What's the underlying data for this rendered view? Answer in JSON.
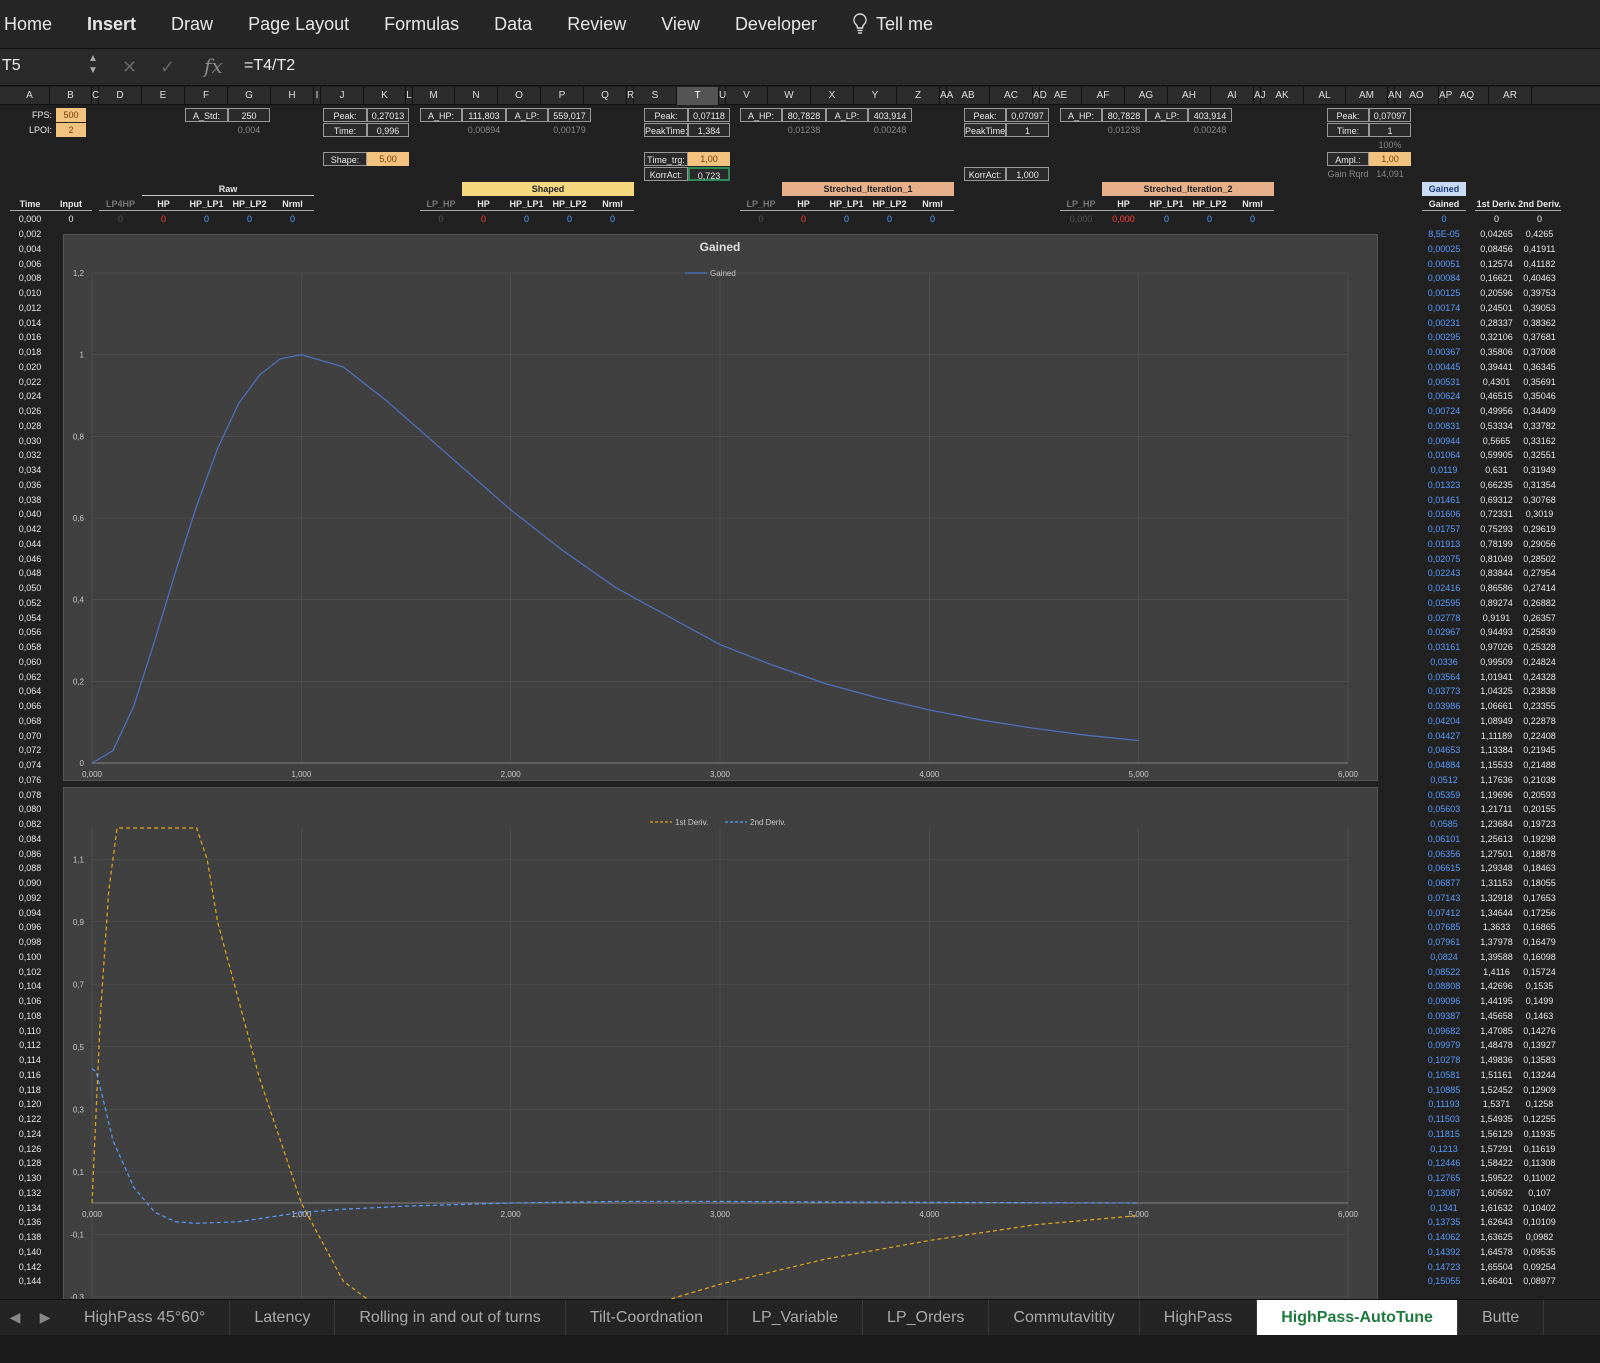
{
  "ribbon": {
    "tabs": [
      "Home",
      "Insert",
      "Draw",
      "Page Layout",
      "Formulas",
      "Data",
      "Review",
      "View",
      "Developer"
    ],
    "tell_me": "Tell me"
  },
  "formula_bar": {
    "name_box": "T5",
    "formula": "=T4/T2",
    "fx": "fx"
  },
  "columns": [
    "A",
    "B",
    "C",
    "D",
    "E",
    "F",
    "G",
    "H",
    "I",
    "J",
    "K",
    "L",
    "M",
    "N",
    "O",
    "P",
    "Q",
    "R",
    "S",
    "T",
    "U",
    "V",
    "W",
    "X",
    "Y",
    "Z",
    "AA",
    "AB",
    "AC",
    "AD",
    "AE",
    "AF",
    "AG",
    "AH",
    "AI",
    "AJ",
    "AK",
    "AL",
    "AM",
    "AN",
    "AO",
    "AP",
    "AQ",
    "AR"
  ],
  "selected_column": "T",
  "params": {
    "fps_label": "FPS:",
    "fps": "500",
    "lpoi_label": "LPOI:",
    "lpoi": "2",
    "astd_label": "A_Std:",
    "astd": "250",
    "astd2": "0,004",
    "peak_label": "Peak:",
    "peak_k": "0,27013",
    "time_label": "Time:",
    "time_k": "0,996",
    "shape_label": "Shape:",
    "shape": "5,00",
    "ahp_label": "A_HP:",
    "ahp_n": "111,803",
    "alp_label": "A_LP:",
    "alp_p": "559,017",
    "n2": "0,00894",
    "p2": "0,00179",
    "peak_t": "0,07118",
    "peaktime_label": "PeakTime:",
    "peaktime_t": "1,384",
    "timetrg_label": "Time_trg:",
    "timetrg": "1,00",
    "korract_label": "KorrAct:",
    "korract_t": "0,723",
    "ahp_w": "80,7828",
    "alp_y": "403,914",
    "w2": "0,01238",
    "y2": "0,00248",
    "peak_ac": "0,07097",
    "peaktime_ac": "1",
    "korract_ac": "1,000",
    "ahp_af": "80,7828",
    "alp_ah": "403,914",
    "af2": "0,01238",
    "ah2": "0,00248",
    "peak_am": "0,07097",
    "time_am": "1",
    "pct": "100%",
    "ampl_label": "Ampl.:",
    "ampl": "1,00",
    "gainrqrd_label": "Gain Rqrd",
    "gainrqrd": "14,091"
  },
  "bands": {
    "raw": "Raw",
    "shaped": "Shaped",
    "str1": "Streched_Iteration_1",
    "str2": "Streched_Iteration_2",
    "gained": "Gained"
  },
  "headers": {
    "time": "Time",
    "input": "Input",
    "lp4hp": "LP4HP",
    "hp": "HP",
    "hp_lp1": "HP_LP1",
    "hp_lp2": "HP_LP2",
    "nrml": "Nrml",
    "lp_hp": "LP_HP",
    "first_deriv": "1st Deriv.",
    "second_deriv": "2nd Deriv."
  },
  "row0": {
    "time": "0,000",
    "input": "0",
    "zero": "0",
    "af": "0,000"
  },
  "times": [
    "0,002",
    "0,004",
    "0,006",
    "0,008",
    "0,010",
    "0,012",
    "0,014",
    "0,016",
    "0,018",
    "0,020",
    "0,022",
    "0,024",
    "0,026",
    "0,028",
    "0,030",
    "0,032",
    "0,034",
    "0,036",
    "0,038",
    "0,040",
    "0,042",
    "0,044",
    "0,046",
    "0,048",
    "0,050",
    "0,052",
    "0,054",
    "0,056",
    "0,058",
    "0,060",
    "0,062",
    "0,064",
    "0,066",
    "0,068",
    "0,070",
    "0,072",
    "0,074",
    "0,076",
    "0,078",
    "0,080",
    "0,082",
    "0,084",
    "0,086",
    "0,088",
    "0,090",
    "0,092",
    "0,094",
    "0,096",
    "0,098",
    "0,100",
    "0,102",
    "0,104",
    "0,106",
    "0,108",
    "0,110",
    "0,112",
    "0,114",
    "0,116",
    "0,118",
    "0,120",
    "0,122",
    "0,124",
    "0,126",
    "0,128",
    "0,130",
    "0,132",
    "0,134",
    "0,136",
    "0,138",
    "0,140",
    "0,142",
    "0,144"
  ],
  "gained": [
    "8,5E-05",
    "0,00025",
    "0,00051",
    "0,00084",
    "0,00125",
    "0,00174",
    "0,00231",
    "0,00295",
    "0,00367",
    "0,00445",
    "0,00531",
    "0,00624",
    "0,00724",
    "0,00831",
    "0,00944",
    "0,01064",
    "0,0119",
    "0,01323",
    "0,01461",
    "0,01606",
    "0,01757",
    "0,01913",
    "0,02075",
    "0,02243",
    "0,02416",
    "0,02595",
    "0,02778",
    "0,02967",
    "0,03161",
    "0,0336",
    "0,03564",
    "0,03773",
    "0,03986",
    "0,04204",
    "0,04427",
    "0,04653",
    "0,04884",
    "0,0512",
    "0,05359",
    "0,05603",
    "0,0585",
    "0,06101",
    "0,06356",
    "0,06615",
    "0,06877",
    "0,07143",
    "0,07412",
    "0,07685",
    "0,07961",
    "0,0824",
    "0,08522",
    "0,08808",
    "0,09096",
    "0,09387",
    "0,09682",
    "0,09979",
    "0,10278",
    "0,10581",
    "0,10885",
    "0,11193",
    "0,11503",
    "0,11815",
    "0,1213",
    "0,12446",
    "0,12765",
    "0,13087",
    "0,1341",
    "0,13735",
    "0,14062",
    "0,14392",
    "0,14723",
    "0,15055"
  ],
  "d1": [
    "0,04265",
    "0,08456",
    "0,12574",
    "0,16621",
    "0,20596",
    "0,24501",
    "0,28337",
    "0,32106",
    "0,35806",
    "0,39441",
    "0,4301",
    "0,46515",
    "0,49956",
    "0,53334",
    "0,5665",
    "0,59905",
    "0,631",
    "0,66235",
    "0,69312",
    "0,72331",
    "0,75293",
    "0,78199",
    "0,81049",
    "0,83844",
    "0,86586",
    "0,89274",
    "0,9191",
    "0,94493",
    "0,97026",
    "0,99509",
    "1,01941",
    "1,04325",
    "1,06661",
    "1,08949",
    "1,11189",
    "1,13384",
    "1,15533",
    "1,17636",
    "1,19696",
    "1,21711",
    "1,23684",
    "1,25613",
    "1,27501",
    "1,29348",
    "1,31153",
    "1,32918",
    "1,34644",
    "1,3633",
    "1,37978",
    "1,39588",
    "1,4116",
    "1,42696",
    "1,44195",
    "1,45658",
    "1,47085",
    "1,48478",
    "1,49836",
    "1,51161",
    "1,52452",
    "1,5371",
    "1,54935",
    "1,56129",
    "1,57291",
    "1,58422",
    "1,59522",
    "1,60592",
    "1,61632",
    "1,62643",
    "1,63625",
    "1,64578",
    "1,65504",
    "1,66401"
  ],
  "d2": [
    "0,4265",
    "0,41911",
    "0,41182",
    "0,40463",
    "0,39753",
    "0,39053",
    "0,38362",
    "0,37681",
    "0,37008",
    "0,36345",
    "0,35691",
    "0,35046",
    "0,34409",
    "0,33782",
    "0,33162",
    "0,32551",
    "0,31949",
    "0,31354",
    "0,30768",
    "0,3019",
    "0,29619",
    "0,29056",
    "0,28502",
    "0,27954",
    "0,27414",
    "0,26882",
    "0,26357",
    "0,25839",
    "0,25328",
    "0,24824",
    "0,24328",
    "0,23838",
    "0,23355",
    "0,22878",
    "0,22408",
    "0,21945",
    "0,21488",
    "0,21038",
    "0,20593",
    "0,20155",
    "0,19723",
    "0,19298",
    "0,18878",
    "0,18463",
    "0,18055",
    "0,17653",
    "0,17256",
    "0,16865",
    "0,16479",
    "0,16098",
    "0,15724",
    "0,1535",
    "0,1499",
    "0,1463",
    "0,14276",
    "0,13927",
    "0,13583",
    "0,13244",
    "0,12909",
    "0,1258",
    "0,12255",
    "0,11935",
    "0,11619",
    "0,11308",
    "0,11002",
    "0,107",
    "0,10402",
    "0,10109",
    "0,0982",
    "0,09535",
    "0,09254",
    "0,08977"
  ],
  "chart_data": [
    {
      "type": "line",
      "title": "Gained",
      "series": [
        {
          "name": "Gained",
          "color": "#4f72c4",
          "x": [
            0,
            0.1,
            0.2,
            0.3,
            0.4,
            0.5,
            0.6,
            0.7,
            0.8,
            0.9,
            1.0,
            1.2,
            1.4,
            1.6,
            1.8,
            2.0,
            2.25,
            2.5,
            2.75,
            3.0,
            3.25,
            3.5,
            3.75,
            4.0,
            4.25,
            4.5,
            4.75,
            5.0
          ],
          "y": [
            0,
            0.03,
            0.14,
            0.3,
            0.47,
            0.63,
            0.77,
            0.88,
            0.95,
            0.99,
            1.0,
            0.97,
            0.89,
            0.8,
            0.71,
            0.62,
            0.52,
            0.43,
            0.36,
            0.29,
            0.24,
            0.195,
            0.16,
            0.13,
            0.105,
            0.085,
            0.068,
            0.055
          ]
        }
      ],
      "xlim": [
        0,
        6
      ],
      "ylim": [
        0,
        1.2
      ],
      "xticks": [
        "0,000",
        "1,000",
        "2,000",
        "3,000",
        "4,000",
        "5,000",
        "6,000"
      ],
      "yticks": [
        "0",
        "0,2",
        "0,4",
        "0,6",
        "0,8",
        "1",
        "1,2"
      ],
      "legend": "top"
    },
    {
      "type": "line",
      "series": [
        {
          "name": "1st Deriv.",
          "color": "#e6a81c",
          "dash": true,
          "x": [
            0,
            0.04,
            0.08,
            0.12,
            0.5,
            0.55,
            0.6,
            0.8,
            1.0,
            1.2,
            1.5,
            2.0,
            2.5,
            3.0,
            3.5,
            4.0,
            4.5,
            5.0
          ],
          "y": [
            0,
            0.6,
            1.0,
            1.3,
            1.3,
            1.1,
            0.9,
            0.4,
            0.0,
            -0.25,
            -0.4,
            -0.48,
            -0.36,
            -0.26,
            -0.18,
            -0.12,
            -0.07,
            -0.04
          ]
        },
        {
          "name": "2nd Deriv.",
          "color": "#5a9bff",
          "dash": true,
          "x": [
            0,
            0.02,
            0.05,
            0.1,
            0.2,
            0.3,
            0.4,
            0.5,
            0.7,
            0.9,
            1.0,
            1.2,
            1.5,
            2.0,
            2.5,
            3.0,
            4.0,
            5.0
          ],
          "y": [
            0.43,
            0.42,
            0.34,
            0.2,
            0.05,
            -0.03,
            -0.06,
            -0.065,
            -0.06,
            -0.04,
            -0.03,
            -0.02,
            -0.01,
            0.0,
            0.005,
            0.005,
            0.002,
            0.0
          ]
        }
      ],
      "xlim": [
        0,
        6
      ],
      "ylim": [
        -0.4,
        1.2
      ],
      "xticks": [
        "0,000",
        "1,000",
        "2,000",
        "3,000",
        "4,000",
        "5,000",
        "6,000"
      ],
      "yticks": [
        "-0,3",
        "-0,1",
        "0,1",
        "0,3",
        "0,5",
        "0,7",
        "0,9",
        "1,1"
      ],
      "legend": "top"
    }
  ],
  "sheets": [
    "HighPass 45°60°",
    "Latency",
    "Rolling in and out of turns",
    "Tilt-Coordnation",
    "LP_Variable",
    "LP_Orders",
    "Commutavitity",
    "HighPass",
    "HighPass-AutoTune",
    "Butte"
  ],
  "active_sheet": "HighPass-AutoTune"
}
